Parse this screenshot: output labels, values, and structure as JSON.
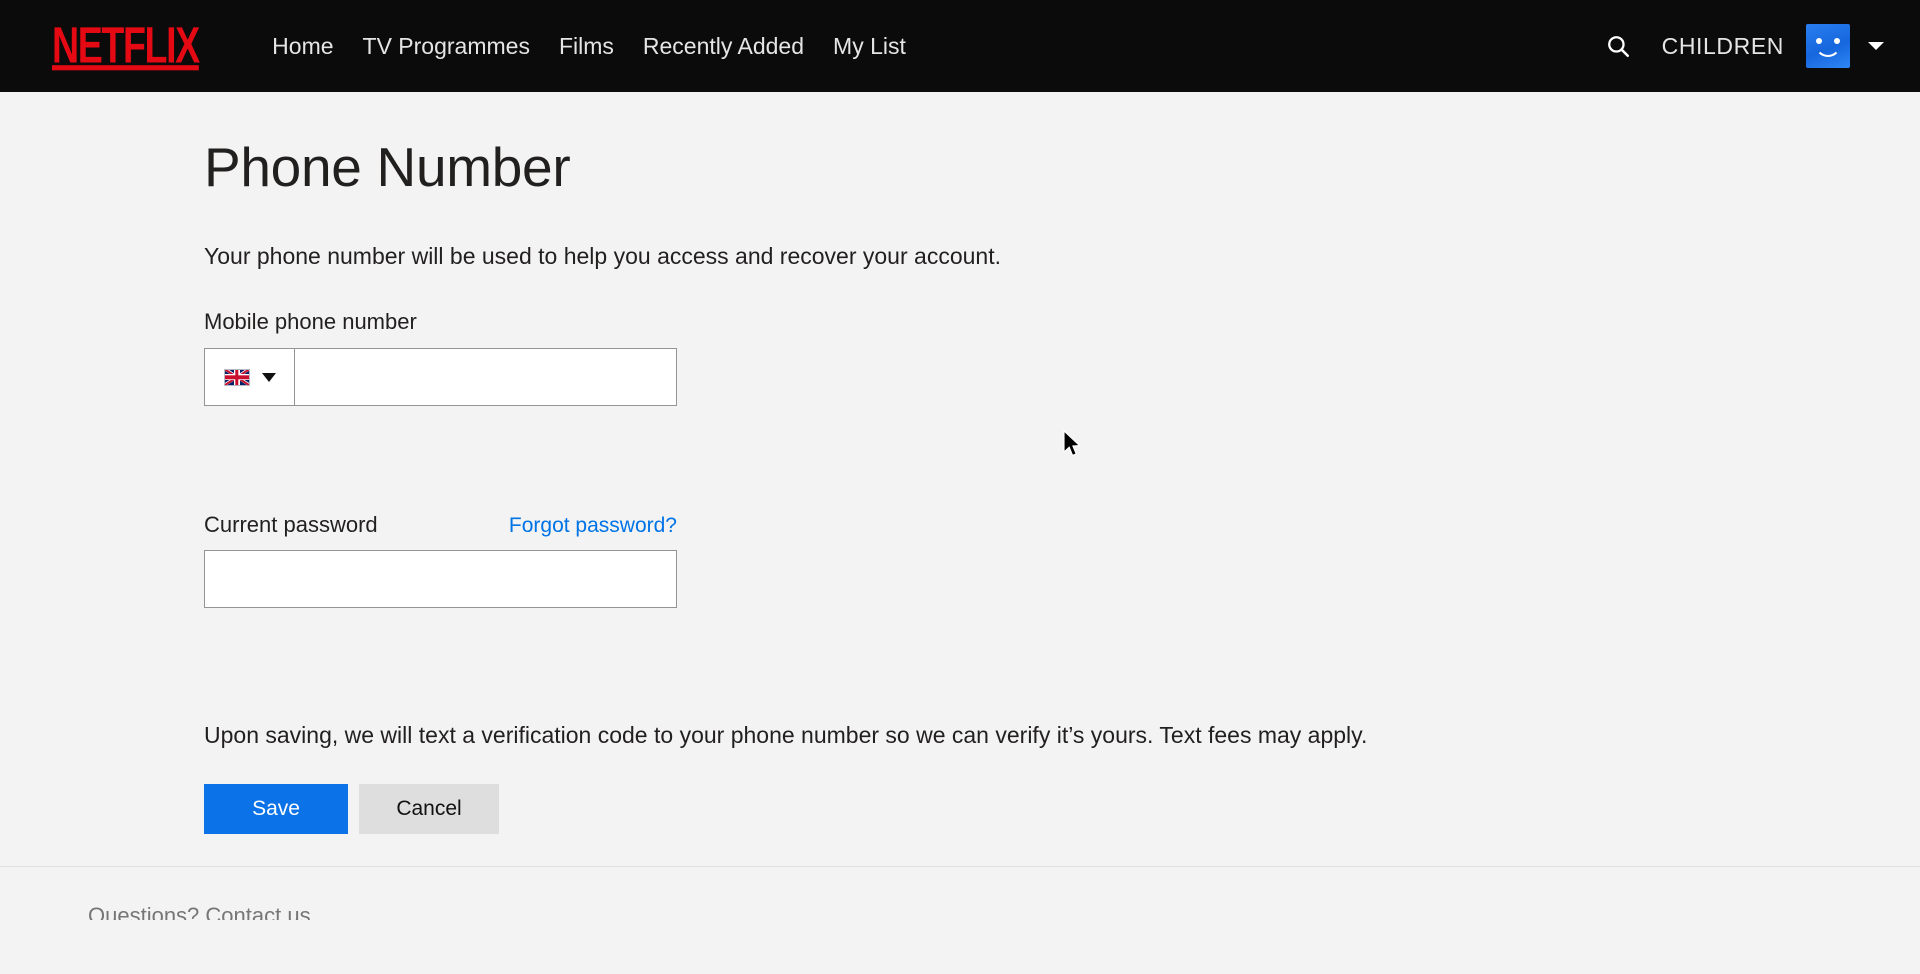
{
  "header": {
    "logo_text": "NETFLIX",
    "logo_color": "#e50914",
    "background_color": "#0b0b0b",
    "nav_items": [
      {
        "label": "Home"
      },
      {
        "label": "TV Programmes"
      },
      {
        "label": "Films"
      },
      {
        "label": "Recently Added"
      },
      {
        "label": "My List"
      }
    ],
    "search_icon": "search-icon",
    "profile_name": "CHILDREN",
    "avatar_icon": "smiley-avatar",
    "avatar_color": "#1f7af0",
    "caret_icon": "chevron-down-icon"
  },
  "page": {
    "title": "Phone Number",
    "description": "Your phone number will be used to help you access and recover your account.",
    "phone": {
      "label": "Mobile phone number",
      "country_flag": "uk-flag-icon",
      "country_caret": "chevron-down-icon",
      "value": "",
      "placeholder": ""
    },
    "password": {
      "label": "Current password",
      "forgot_label": "Forgot password?",
      "forgot_color": "#0073e6",
      "value": "",
      "placeholder": ""
    },
    "verify_note": "Upon saving, we will text a verification code to your phone number so we can verify it’s yours. Text fees may apply.",
    "buttons": {
      "save_label": "Save",
      "save_color": "#0b72e7",
      "cancel_label": "Cancel",
      "cancel_color": "#dedede"
    }
  },
  "footer": {
    "contact_label": "Questions? Contact us"
  }
}
